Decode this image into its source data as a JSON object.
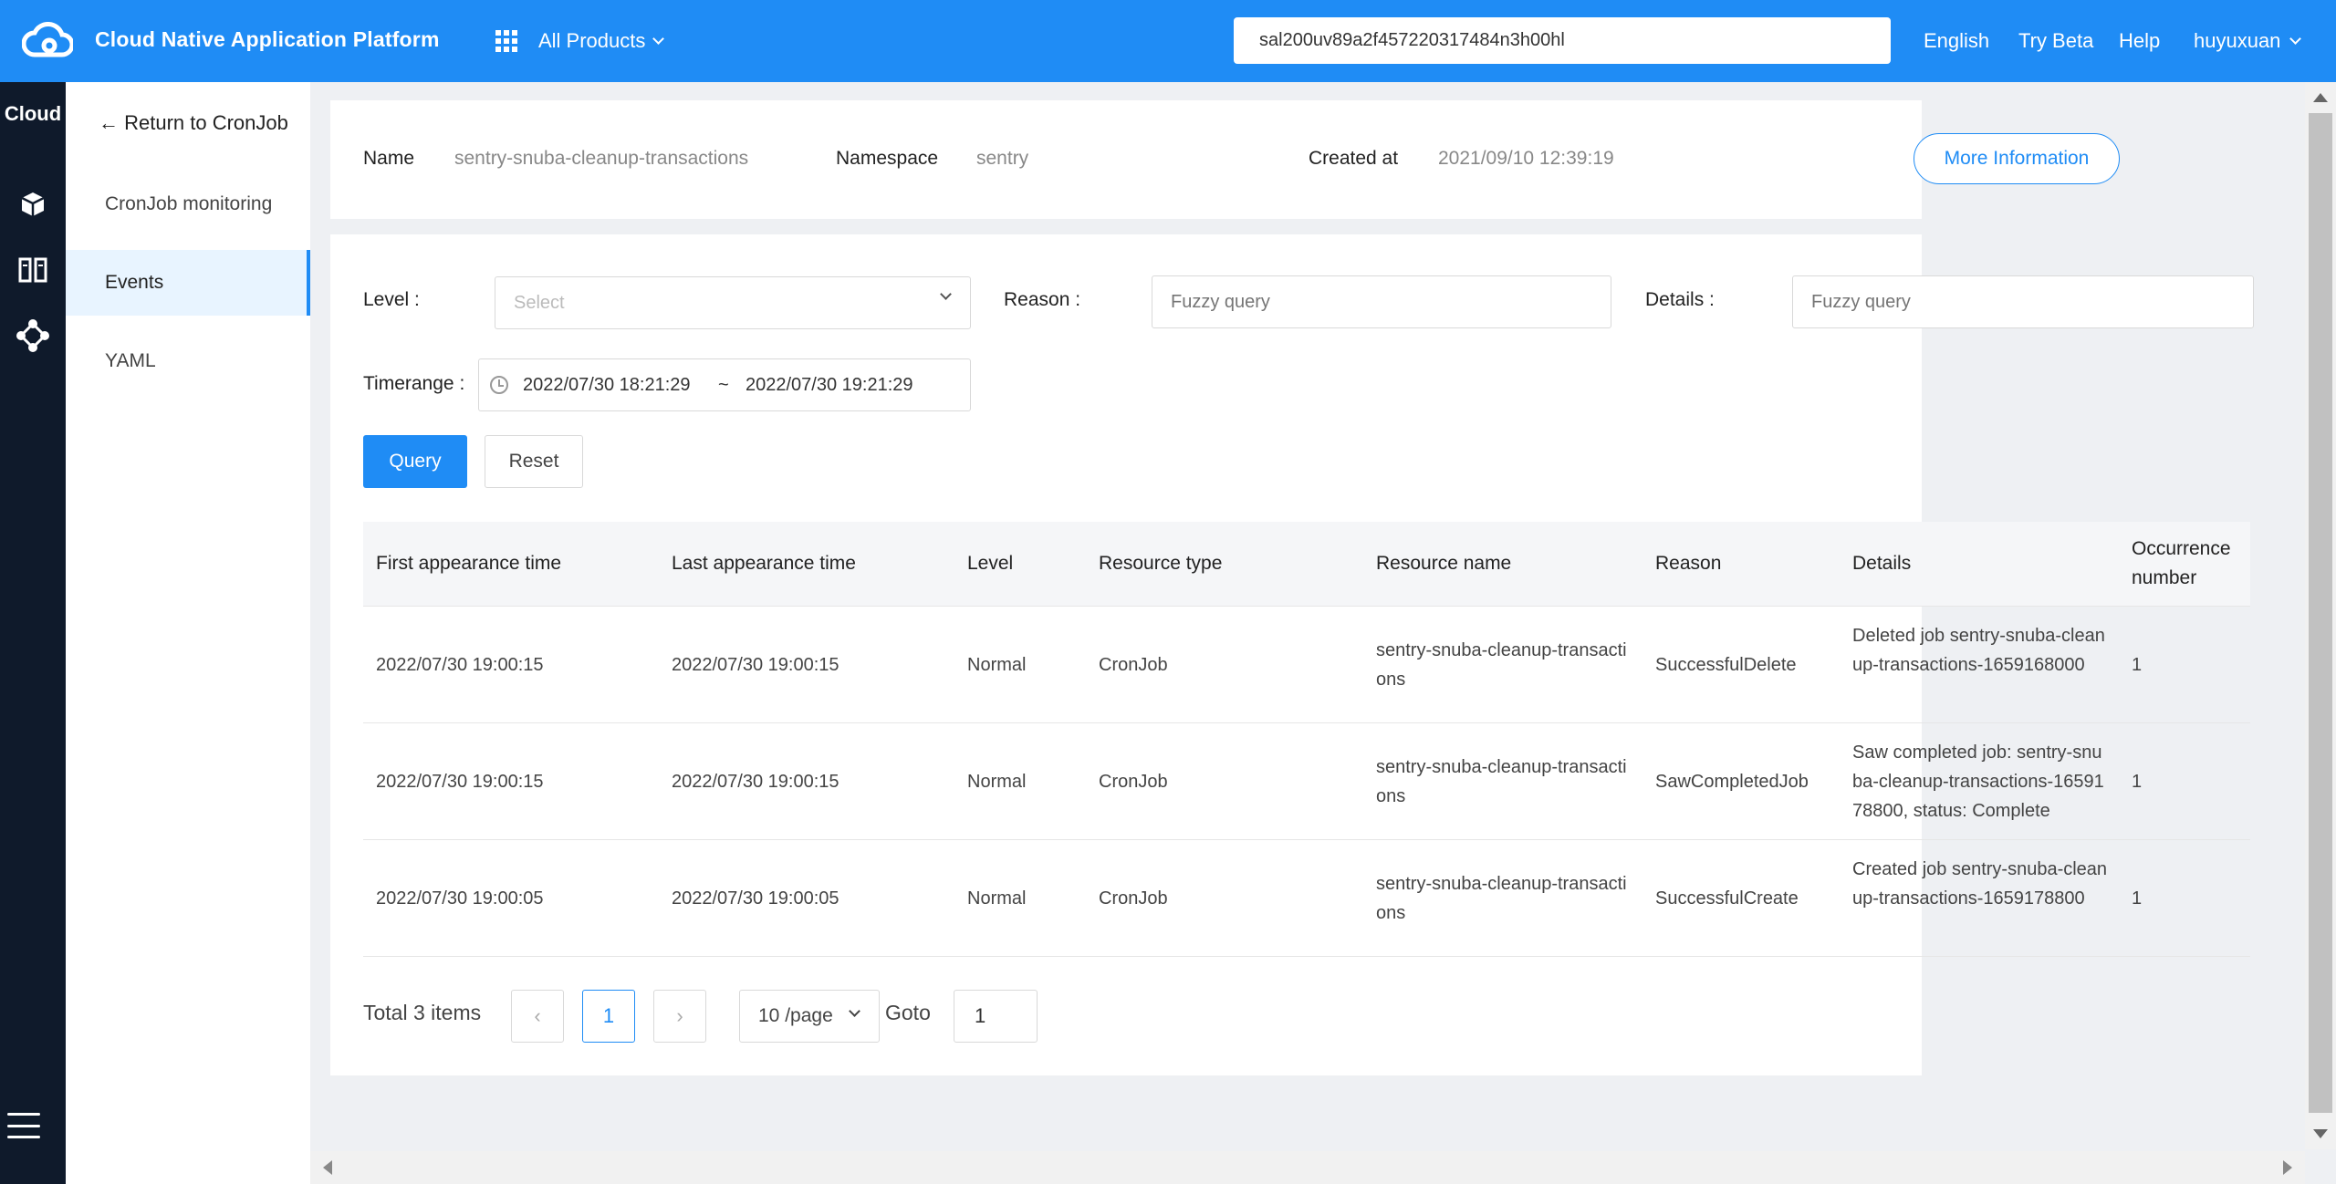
{
  "header": {
    "app_title": "Cloud Native Application Platform",
    "all_products": "All Products",
    "search_value": "sal200uv89a2f457220317484n3h00hl",
    "links": [
      "English",
      "Try Beta",
      "Help"
    ],
    "user": "huyuxuan",
    "brand_color": "#1f8cf5"
  },
  "rail": {
    "label": "Cloud",
    "icons": [
      "cube-icon",
      "columns-icon",
      "network-icon",
      "menu-icon"
    ]
  },
  "sidebar": {
    "back": "← Return to CronJob",
    "items": [
      {
        "label": "CronJob monitoring",
        "active": false
      },
      {
        "label": "Events",
        "active": true
      },
      {
        "label": "YAML",
        "active": false
      }
    ]
  },
  "info": {
    "name_label": "Name",
    "name_value": "sentry-snuba-cleanup-transactions",
    "namespace_label": "Namespace",
    "namespace_value": "sentry",
    "created_label": "Created at",
    "created_value": "2021/09/10 12:39:19",
    "more_button": "More Information"
  },
  "filters": {
    "level_label": "Level",
    "level_placeholder": "Select",
    "reason_label": "Reason",
    "reason_placeholder": "Fuzzy query",
    "details_label": "Details",
    "details_placeholder": "Fuzzy query",
    "timerange_label": "Timerange",
    "time_start": "2022/07/30 18:21:29",
    "time_sep": "~",
    "time_end": "2022/07/30 19:21:29",
    "query_button": "Query",
    "reset_button": "Reset"
  },
  "table": {
    "headers": [
      "First appearance time",
      "Last appearance time",
      "Level",
      "Resource type",
      "Resource name",
      "Reason",
      "Details",
      "Occurrence number"
    ],
    "rows": [
      {
        "first": "2022/07/30 19:00:15",
        "last": "2022/07/30 19:00:15",
        "level": "Normal",
        "type": "CronJob",
        "name": "sentry-snuba-cleanup-transactions",
        "reason": "SuccessfulDelete",
        "details": "Deleted job sentry-snuba-cleanup-transactions-1659168000",
        "count": "1"
      },
      {
        "first": "2022/07/30 19:00:15",
        "last": "2022/07/30 19:00:15",
        "level": "Normal",
        "type": "CronJob",
        "name": "sentry-snuba-cleanup-transactions",
        "reason": "SawCompletedJob",
        "details": "Saw completed job: sentry-snuba-cleanup-transactions-1659178800, status: Complete",
        "count": "1"
      },
      {
        "first": "2022/07/30 19:00:05",
        "last": "2022/07/30 19:00:05",
        "level": "Normal",
        "type": "CronJob",
        "name": "sentry-snuba-cleanup-transactions",
        "reason": "SuccessfulCreate",
        "details": "Created job sentry-snuba-cleanup-transactions-1659178800",
        "count": "1"
      }
    ]
  },
  "pagination": {
    "total": "Total 3 items",
    "current_page": "1",
    "page_size": "10 /page",
    "goto_label": "Goto",
    "goto_value": "1"
  }
}
